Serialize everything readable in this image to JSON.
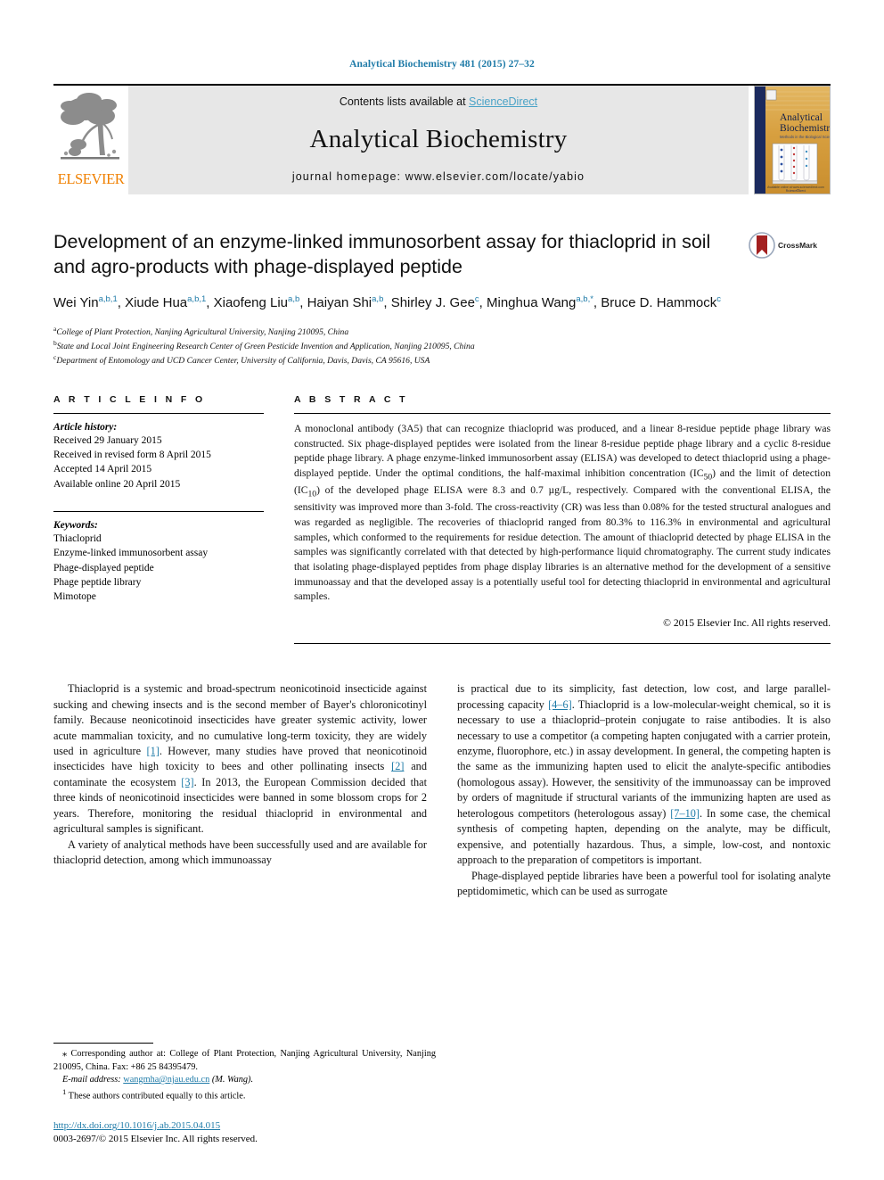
{
  "running_head": "Analytical Biochemistry 481 (2015) 27–32",
  "masthead": {
    "publisher_name": "ELSEVIER",
    "contents_prefix": "Contents lists available at ",
    "sciencedirect": "ScienceDirect",
    "journal_title": "Analytical Biochemistry",
    "homepage_line": "journal homepage: www.elsevier.com/locate/yabio",
    "cover": {
      "title_line1": "Analytical",
      "title_line2": "Biochemistry",
      "subtitle": "Methods in the Biological Sciences"
    },
    "band_color": "#e7e7e7",
    "link_color": "#4aa3c7",
    "brand_orange": "#f08000"
  },
  "article": {
    "title": "Development of an enzyme-linked immunosorbent assay for thiacloprid in soil and agro-products with phage-displayed peptide",
    "crossmark_label": "CrossMark",
    "authors": [
      {
        "name": "Wei Yin",
        "sup": "a,b,1",
        "sep": ", "
      },
      {
        "name": "Xiude Hua",
        "sup": "a,b,1",
        "sep": ", "
      },
      {
        "name": "Xiaofeng Liu",
        "sup": "a,b",
        "sep": ", "
      },
      {
        "name": "Haiyan Shi",
        "sup": "a,b",
        "sep": ", "
      },
      {
        "name": "Shirley J. Gee",
        "sup": "c",
        "sep": ", "
      },
      {
        "name": "Minghua Wang",
        "sup": "a,b,*",
        "sep": ", "
      },
      {
        "name": "Bruce D. Hammock",
        "sup": "c",
        "sep": ""
      }
    ],
    "affiliations": [
      {
        "mark": "a",
        "text": "College of Plant Protection, Nanjing Agricultural University, Nanjing 210095, China"
      },
      {
        "mark": "b",
        "text": "State and Local Joint Engineering Research Center of Green Pesticide Invention and Application, Nanjing 210095, China"
      },
      {
        "mark": "c",
        "text": "Department of Entomology and UCD Cancer Center, University of California, Davis, Davis, CA 95616, USA"
      }
    ]
  },
  "article_info": {
    "heading": "A R T I C L E  I N F O",
    "history_label": "Article history:",
    "history": [
      "Received 29 January 2015",
      "Received in revised form 8 April 2015",
      "Accepted 14 April 2015",
      "Available online 20 April 2015"
    ],
    "keywords_label": "Keywords:",
    "keywords": [
      "Thiacloprid",
      "Enzyme-linked immunosorbent assay",
      "Phage-displayed peptide",
      "Phage peptide library",
      "Mimotope"
    ]
  },
  "abstract": {
    "heading": "A B S T R A C T",
    "text_part1": "A monoclonal antibody (3A5) that can recognize thiacloprid was produced, and a linear 8-residue peptide phage library was constructed. Six phage-displayed peptides were isolated from the linear 8-residue peptide phage library and a cyclic 8-residue peptide phage library. A phage enzyme-linked immunosorbent assay (ELISA) was developed to detect thiacloprid using a phage-displayed peptide. Under the optimal conditions, the half-maximal inhibition concentration (IC",
    "sub1": "50",
    "text_part2": ") and the limit of detection (IC",
    "sub2": "10",
    "text_part3": ") of the developed phage ELISA were 8.3 and 0.7 µg/L, respectively. Compared with the conventional ELISA, the sensitivity was improved more than 3-fold. The cross-reactivity (CR) was less than 0.08% for the tested structural analogues and was regarded as negligible. The recoveries of thiacloprid ranged from 80.3% to 116.3% in environmental and agricultural samples, which conformed to the requirements for residue detection. The amount of thiacloprid detected by phage ELISA in the samples was significantly correlated with that detected by high-performance liquid chromatography. The current study indicates that isolating phage-displayed peptides from phage display libraries is an alternative method for the development of a sensitive immunoassay and that the developed assay is a potentially useful tool for detecting thiacloprid in environmental and agricultural samples.",
    "copyright": "© 2015 Elsevier Inc. All rights reserved."
  },
  "body": {
    "left": {
      "p1_a": "Thiacloprid is a systemic and broad-spectrum neonicotinoid insecticide against sucking and chewing insects and is the second member of Bayer's chloronicotinyl family. Because neonicotinoid insecticides have greater systemic activity, lower acute mammalian toxicity, and no cumulative long-term toxicity, they are widely used in agriculture ",
      "cite1": "[1]",
      "p1_b": ". However, many studies have proved that neonicotinoid insecticides have high toxicity to bees and other pollinating insects ",
      "cite2": "[2]",
      "p1_c": " and contaminate the ecosystem ",
      "cite3": "[3]",
      "p1_d": ". In 2013, the European Commission decided that three kinds of neonicotinoid insecticides were banned in some blossom crops for 2 years. Therefore, monitoring the residual thiacloprid in environmental and agricultural samples is significant.",
      "p2": "A variety of analytical methods have been successfully used and are available for thiacloprid detection, among which immunoassay"
    },
    "right": {
      "p1_a": "is practical due to its simplicity, fast detection, low cost, and large parallel-processing capacity ",
      "cite1": "[4–6]",
      "p1_b": ". Thiacloprid is a low-molecular-weight chemical, so it is necessary to use a thiacloprid–protein conjugate to raise antibodies. It is also necessary to use a competitor (a competing hapten conjugated with a carrier protein, enzyme, fluorophore, etc.) in assay development. In general, the competing hapten is the same as the immunizing hapten used to elicit the analyte-specific antibodies (homologous assay). However, the sensitivity of the immunoassay can be improved by orders of magnitude if structural variants of the immunizing hapten are used as heterologous competitors (heterologous assay) ",
      "cite2": "[7–10]",
      "p1_c": ". In some case, the chemical synthesis of competing hapten, depending on the analyte, may be difficult, expensive, and potentially hazardous. Thus, a simple, low-cost, and nontoxic approach to the preparation of competitors is important.",
      "p2": "Phage-displayed peptide libraries have been a powerful tool for isolating analyte peptidomimetic, which can be used as surrogate"
    }
  },
  "footnotes": {
    "corresponding_mark": "⁎",
    "corresponding": " Corresponding author at: College of Plant Protection, Nanjing Agricultural University, Nanjing 210095, China. Fax: +86 25 84395479.",
    "email_label": "E-mail address:",
    "email": "wangmha@njau.edu.cn",
    "email_suffix": " (M. Wang).",
    "equal_mark": "1",
    "equal_contrib": " These authors contributed equally to this article.",
    "doi": "http://dx.doi.org/10.1016/j.ab.2015.04.015",
    "issn_line": "0003-2697/© 2015 Elsevier Inc. All rights reserved."
  }
}
